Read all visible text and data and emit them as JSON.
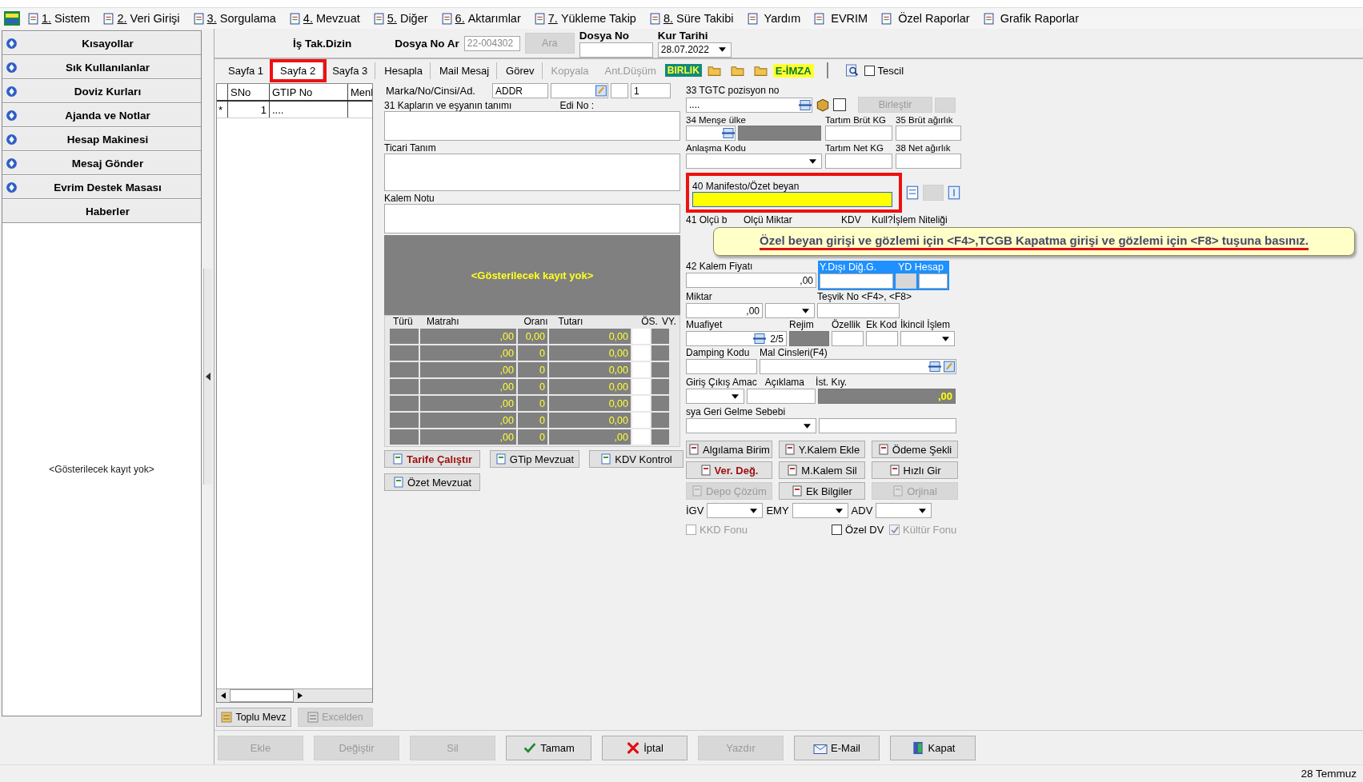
{
  "menu": [
    {
      "number": "1.",
      "label": "Sistem"
    },
    {
      "number": "2.",
      "label": "Veri Girişi"
    },
    {
      "number": "3.",
      "label": "Sorgulama"
    },
    {
      "number": "4.",
      "label": "Mevzuat"
    },
    {
      "number": "5.",
      "label": "Diğer"
    },
    {
      "number": "6.",
      "label": "Aktarımlar"
    },
    {
      "number": "7.",
      "label": "Yükleme Takip"
    },
    {
      "number": "8.",
      "label": "Süre Takibi"
    },
    {
      "label": "Yardım"
    },
    {
      "label": "EVRIM"
    },
    {
      "label": "Özel Raporlar"
    },
    {
      "label": "Grafik Raporlar"
    }
  ],
  "sidebar": {
    "items": [
      {
        "label": "Kısayollar",
        "has_icon": true
      },
      {
        "label": "Sık Kullanılanlar",
        "has_icon": true
      },
      {
        "label": "Doviz Kurları",
        "has_icon": true
      },
      {
        "label": "Ajanda ve Notlar",
        "has_icon": true
      },
      {
        "label": "Hesap Makinesi",
        "has_icon": true
      },
      {
        "label": "Mesaj Gönder",
        "has_icon": true
      },
      {
        "label": "Evrim Destek Masası",
        "has_icon": true
      },
      {
        "label": "Haberler",
        "has_icon": false
      }
    ],
    "empty_text": "<Gösterilecek kayıt yok>"
  },
  "header": {
    "dizin_label": "İş Tak.Dizin",
    "dosya_ar_label": "Dosya No Ar",
    "dosya_ar_value": "22-004302",
    "search_button": {
      "label": "Ara",
      "disabled": true
    },
    "dosya_no_label": "Dosya No",
    "kur_tarihi_label": "Kur Tarihi",
    "kur_tarihi_value": "28.07.2022"
  },
  "tabs": [
    {
      "label": "Sayfa 1",
      "selected": false,
      "disabled": false,
      "highlighted": false
    },
    {
      "label": "Sayfa 2",
      "selected": true,
      "disabled": false,
      "highlighted": true
    },
    {
      "label": "Sayfa 3",
      "selected": false,
      "disabled": false,
      "highlighted": false
    },
    {
      "label": "Hesapla",
      "selected": false,
      "disabled": false,
      "highlighted": false
    },
    {
      "label": "Mail Mesaj",
      "selected": false,
      "disabled": false,
      "highlighted": false
    },
    {
      "label": "Görev",
      "selected": false,
      "disabled": false,
      "highlighted": false
    },
    {
      "label": "Kopyala",
      "selected": false,
      "disabled": true,
      "highlighted": false
    },
    {
      "label": "Ant.Düşüm",
      "selected": false,
      "disabled": true,
      "highlighted": false
    }
  ],
  "toolbar": {
    "birlik_badge": "BIRLIK",
    "eimza_badge": "E-İMZA",
    "tescil": {
      "label": "Tescil",
      "checked": false
    }
  },
  "items_grid": {
    "columns": [
      "SNo",
      "GTIP No",
      "Menl"
    ],
    "rows": [
      {
        "marker": "*",
        "cells": [
          "1",
          "...."
        ]
      }
    ],
    "buttons": [
      {
        "label": "Toplu Mevz",
        "disabled": false
      },
      {
        "label": "Excelden",
        "disabled": true
      }
    ]
  },
  "item_form": {
    "marka_label": "Marka/No/Cinsi/Ad.",
    "marka_value": "ADDR",
    "count_value": "1",
    "tanim_label": "31 Kapların ve eşyanın tanımı",
    "edi_label": "Edi No :",
    "ticari_label": "Ticari Tanım",
    "kalem_notu_label": "Kalem Notu",
    "empty_text": "<Gösterilecek kayıt yok>",
    "tax_table": {
      "columns": [
        "Türü",
        "Matrahı",
        "Oranı",
        "Tutarı",
        "ÖS.",
        "VY."
      ],
      "rows": [
        {
          "matrah": ",00",
          "oran": "0,00",
          "tutar": "0,00"
        },
        {
          "matrah": ",00",
          "oran": "0",
          "tutar": "0,00"
        },
        {
          "matrah": ",00",
          "oran": "0",
          "tutar": "0,00"
        },
        {
          "matrah": ",00",
          "oran": "0",
          "tutar": "0,00"
        },
        {
          "matrah": ",00",
          "oran": "0",
          "tutar": "0,00"
        },
        {
          "matrah": ",00",
          "oran": "0",
          "tutar": "0,00"
        },
        {
          "matrah": ",00",
          "oran": "0",
          "tutar": ",00"
        }
      ]
    },
    "buttons": [
      {
        "label": "Tarife Çalıştır",
        "emphasis": true
      },
      {
        "label": "GTip Mevzuat",
        "emphasis": false
      },
      {
        "label": "KDV Kontrol",
        "emphasis": false
      },
      {
        "label": "Özet Mevzuat",
        "emphasis": false
      }
    ]
  },
  "detail_form": {
    "tgtc_label": "33 TGTC pozisyon no",
    "tgtc_value": "....",
    "merge_button": {
      "label": "Birleştir",
      "disabled": true
    },
    "merge_check": {
      "checked": false
    },
    "mense_label": "34 Menşe ülke",
    "brut_tartim_label": "Tartım Brüt KG",
    "brut_label": "35 Brüt ağırlık",
    "anlasma_label": "Anlaşma Kodu",
    "net_tartim_label": "Tartım Net KG",
    "net_label": "38 Net ağırlık",
    "manifesto": {
      "label": "40 Manifesto/Özet beyan",
      "highlighted": true
    },
    "olcu_labels": [
      "41 Olçü b",
      "Olçü Miktar",
      "KDV",
      "Kull?İşlem Niteliği"
    ],
    "tooltip": {
      "text": "Özel beyan girişi ve gözlemi için <F4>,TCGB Kapatma girişi ve gözlemi için <F8> tuşuna basınız.",
      "highlighted": true
    },
    "kalem_fiyati_label": "42 Kalem Fiyatı",
    "kalem_fiyati_value": ",00",
    "yd_diger_label": "Y.Dışı Diğ.G.",
    "yd_hesap_label": "YD Hesap",
    "miktar_label": "Miktar",
    "miktar_value": ",00",
    "tesvik_label": "Teşvik No <F4>, <F8>",
    "muafiyet_label": "Muafiyet",
    "muafiyet_counter": "2/5",
    "rejim_label": "Rejim",
    "ozellik_label": "Özellik",
    "ek_kod_label": "Ek Kod",
    "ikincil_label": "İkincil İşlem",
    "damping_label": "Damping Kodu",
    "mal_cinsleri_label": "Mal Cinsleri(F4)",
    "giris_label": "Giriş Çıkış Amac",
    "aciklama_label": "Açıklama",
    "ist_kiy_label": "İst. Kıy.",
    "ist_kiy_value": ",00",
    "geri_gelme_label": "sya Geri Gelme Sebebi",
    "buttons": [
      {
        "label": "Algılama Birim",
        "disabled": false,
        "emphasis": false
      },
      {
        "label": "Y.Kalem Ekle",
        "disabled": false,
        "emphasis": false
      },
      {
        "label": "Ödeme Şekli",
        "disabled": false,
        "emphasis": false
      },
      {
        "label": "Ver. Değ.",
        "disabled": false,
        "emphasis": true
      },
      {
        "label": "M.Kalem Sil",
        "disabled": false,
        "emphasis": false
      },
      {
        "label": "Hızlı Gir",
        "disabled": false,
        "emphasis": false
      },
      {
        "label": "Depo Çözüm",
        "disabled": true,
        "emphasis": false
      },
      {
        "label": "Ek Bilgiler",
        "disabled": false,
        "emphasis": false
      },
      {
        "label": "Orjinal",
        "disabled": true,
        "emphasis": false
      }
    ],
    "combos": [
      "İGV",
      "EMY",
      "ADV"
    ],
    "checks": [
      {
        "label": "KKD Fonu",
        "checked": false,
        "disabled": true
      },
      {
        "label": "Özel DV",
        "checked": false,
        "disabled": false
      },
      {
        "label": "Kültür Fonu",
        "checked": true,
        "disabled": true
      }
    ]
  },
  "bottom_buttons": [
    {
      "label": "Ekle",
      "disabled": true,
      "kind": "plain"
    },
    {
      "label": "Değiştir",
      "disabled": true,
      "kind": "plain"
    },
    {
      "label": "Sil",
      "disabled": true,
      "kind": "plain"
    },
    {
      "label": "Tamam",
      "disabled": false,
      "kind": "confirm"
    },
    {
      "label": "İptal",
      "disabled": false,
      "kind": "cancel"
    },
    {
      "label": "Yazdır",
      "disabled": true,
      "kind": "plain"
    },
    {
      "label": "E-Mail",
      "disabled": false,
      "kind": "mail"
    },
    {
      "label": "Kapat",
      "disabled": false,
      "kind": "exit"
    }
  ],
  "status_bar": {
    "date": "28 Temmuz"
  }
}
